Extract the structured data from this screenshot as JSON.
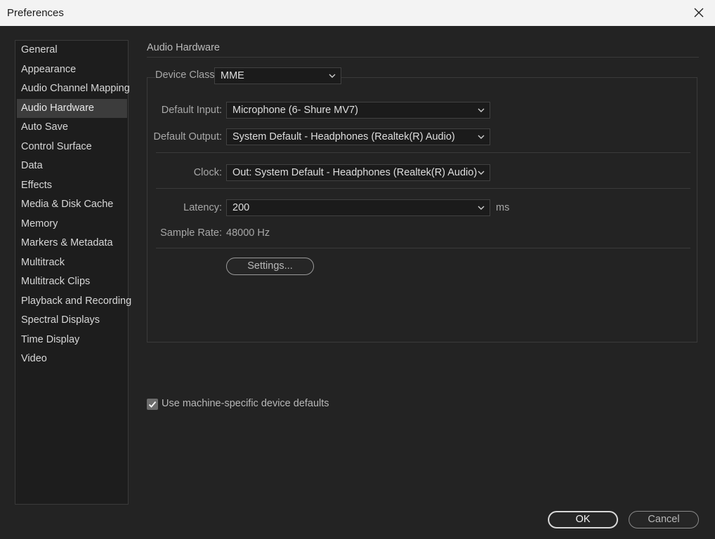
{
  "window": {
    "title": "Preferences",
    "close_icon": "close-icon"
  },
  "sidebar": {
    "items": [
      {
        "label": "General"
      },
      {
        "label": "Appearance"
      },
      {
        "label": "Audio Channel Mapping"
      },
      {
        "label": "Audio Hardware",
        "selected": true
      },
      {
        "label": "Auto Save"
      },
      {
        "label": "Control Surface"
      },
      {
        "label": "Data"
      },
      {
        "label": "Effects"
      },
      {
        "label": "Media & Disk Cache"
      },
      {
        "label": "Memory"
      },
      {
        "label": "Markers & Metadata"
      },
      {
        "label": "Multitrack"
      },
      {
        "label": "Multitrack Clips"
      },
      {
        "label": "Playback and Recording"
      },
      {
        "label": "Spectral Displays"
      },
      {
        "label": "Time Display"
      },
      {
        "label": "Video"
      }
    ]
  },
  "main": {
    "section_title": "Audio Hardware",
    "device_class": {
      "label": "Device Class:",
      "value": "MME"
    },
    "default_input": {
      "label": "Default Input:",
      "value": "Microphone (6- Shure MV7)"
    },
    "default_output": {
      "label": "Default Output:",
      "value": "System Default - Headphones (Realtek(R) Audio)"
    },
    "clock": {
      "label": "Clock:",
      "value": "Out: System Default - Headphones (Realtek(R) Audio)"
    },
    "latency": {
      "label": "Latency:",
      "value": "200",
      "unit": "ms"
    },
    "sample_rate": {
      "label": "Sample Rate:",
      "value": "48000 Hz"
    },
    "settings_button": "Settings...",
    "machine_defaults": {
      "label": "Use machine-specific device defaults",
      "checked": true
    }
  },
  "footer": {
    "ok": "OK",
    "cancel": "Cancel"
  },
  "colors": {
    "background": "#232323",
    "panel": "#1d1d1d",
    "selected": "#3c3c3c",
    "titlebar": "#f3f3f3"
  }
}
